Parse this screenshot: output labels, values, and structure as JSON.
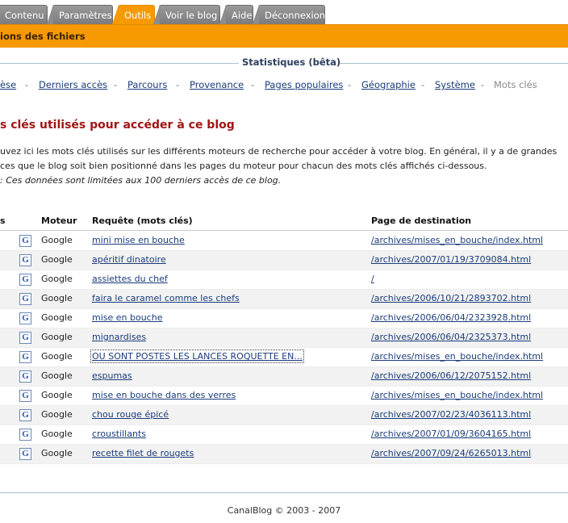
{
  "tabs": [
    {
      "label": "Contenu"
    },
    {
      "label": "Paramètres"
    },
    {
      "label": "Outils"
    },
    {
      "label": "Voir le blog"
    },
    {
      "label": "Aide"
    },
    {
      "label": "Déconnexion"
    }
  ],
  "orange_bar": {
    "label": "ions des fichiers"
  },
  "section_title": "Statistiques (bêta)",
  "subnav": [
    {
      "label": "èse",
      "current": false
    },
    {
      "label": "Derniers accès",
      "current": false
    },
    {
      "label": "Parcours",
      "current": false
    },
    {
      "label": "Provenance",
      "current": false
    },
    {
      "label": "Pages populaires",
      "current": false
    },
    {
      "label": "Géographie",
      "current": false
    },
    {
      "label": "Système",
      "current": false
    },
    {
      "label": "Mots clés",
      "current": true
    }
  ],
  "subnav_separator": "-",
  "heading": "s clés utilisés pour accéder à ce blog",
  "intro": {
    "line1": "uvez ici les mots clés utilisés sur les différents moteurs de recherche pour accéder à votre blog. En général, il y a de grandes",
    "line2": "ces que le blog soit bien positionné dans les pages du moteur pour chacun des mots clés affichés ci-dessous.",
    "note": ": Ces données sont limitées aux 100 derniers accès de ce blog."
  },
  "table": {
    "headers": {
      "col0": "s",
      "engine": "Moteur",
      "query": "Requête (mots clés)",
      "page": "Page de destination"
    },
    "engine_icon_glyph": "G",
    "rows": [
      {
        "engine": "Google",
        "query": "mini mise en bouche",
        "page": "/archives/mises_en_bouche/index.html"
      },
      {
        "engine": "Google",
        "query": "apéritif dinatoire",
        "page": "/archives/2007/01/19/3709084.html"
      },
      {
        "engine": "Google",
        "query": "assiettes du chef",
        "page": "/"
      },
      {
        "engine": "Google",
        "query": "faira le caramel comme les chefs",
        "page": "/archives/2006/10/21/2893702.html"
      },
      {
        "engine": "Google",
        "query": "mise en bouche",
        "page": "/archives/2006/06/04/2323928.html"
      },
      {
        "engine": "Google",
        "query": "mignardises",
        "page": "/archives/2006/06/04/2325373.html"
      },
      {
        "engine": "Google",
        "query": "OU SONT POSTES LES LANCES ROQUETTE EN...",
        "page": "/archives/mises_en_bouche/index.html"
      },
      {
        "engine": "Google",
        "query": "espumas",
        "page": "/archives/2006/06/12/2075152.html"
      },
      {
        "engine": "Google",
        "query": "mise en bouche dans des verres",
        "page": "/archives/mises_en_bouche/index.html"
      },
      {
        "engine": "Google",
        "query": "chou rouge épicé",
        "page": "/archives/2007/02/23/4036113.html"
      },
      {
        "engine": "Google",
        "query": "croustillants",
        "page": "/archives/2007/01/09/3604165.html"
      },
      {
        "engine": "Google",
        "query": "recette filet de rougets",
        "page": "/archives/2007/09/24/6265013.html"
      }
    ]
  },
  "footer": "CanalBlog © 2003 - 2007",
  "colors": {
    "accent": "#f79900",
    "heading": "#a31515",
    "link": "#1a3c7a"
  }
}
